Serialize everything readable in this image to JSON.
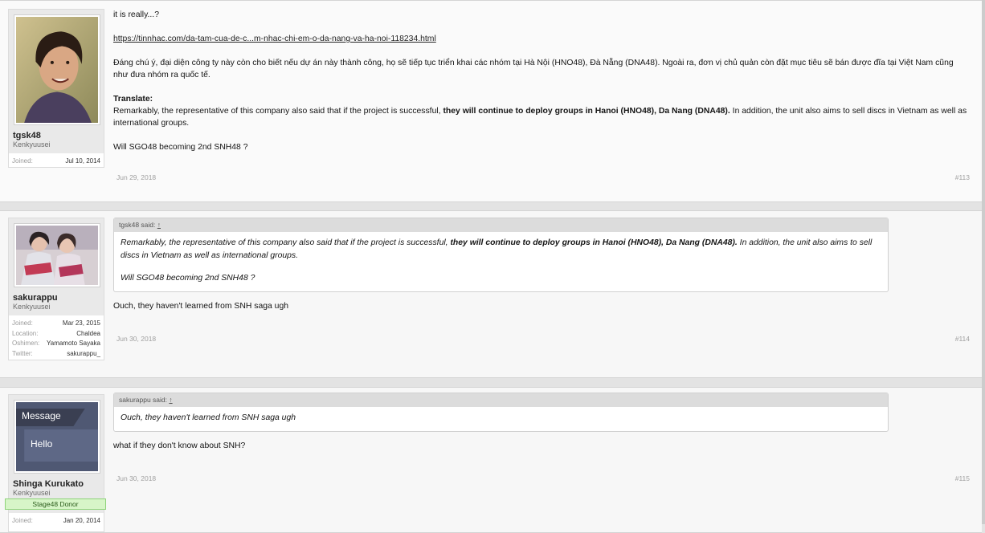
{
  "posts": [
    {
      "user": {
        "name": "tgsk48",
        "title": "Kenkyuusei",
        "joined_label": "Joined:",
        "joined": "Jul 10, 2014"
      },
      "intro": "it is really...?",
      "link": "https://tinnhac.com/da-tam-cua-de-c...m-nhac-chi-em-o-da-nang-va-ha-noi-118234.html",
      "viet": "Đáng chú ý, đại diện công ty này còn cho biết nếu dự án này thành công, họ sẽ tiếp tục triển khai các nhóm tại Hà Nội (HNO48), Đà Nẵng (DNA48). Ngoài ra, đơn vị chủ quản còn đặt mục tiêu sẽ bán được đĩa tại Việt Nam cũng như đưa nhóm ra quốc tế.",
      "translate_label": "Translate:",
      "tr_a": "Remarkably, the representative of this company also said that if the project is successful, ",
      "tr_b": "they will continue to deploy groups in Hanoi (HNO48), Da Nang (DNA48).",
      "tr_c": " In addition, the unit also aims to sell discs in Vietnam as well as international groups.",
      "closing": "Will SGO48 becoming 2nd SNH48 ?",
      "date": "Jun 29, 2018",
      "number": "#113"
    },
    {
      "user": {
        "name": "sakurappu",
        "title": "Kenkyuusei",
        "fields": [
          {
            "label": "Joined:",
            "value": "Mar 23, 2015"
          },
          {
            "label": "Location:",
            "value": "Chaldea"
          },
          {
            "label": "Oshimen:",
            "value": "Yamamoto Sayaka"
          },
          {
            "label": "Twitter:",
            "value": "sakurappu_"
          }
        ]
      },
      "quote_author": "tgsk48 said:",
      "quote_arrow": "↑",
      "q_a": "Remarkably, the representative of this company also said that if the project is successful, ",
      "q_b": "they will continue to deploy groups in Hanoi (HNO48), Da Nang (DNA48).",
      "q_c": " In addition, the unit also aims to sell discs in Vietnam as well as international groups.",
      "q_closing": "Will SGO48 becoming 2nd SNH48 ?",
      "message": "Ouch, they haven't learned from SNH saga ugh",
      "date": "Jun 30, 2018",
      "number": "#114"
    },
    {
      "user": {
        "name": "Shinga Kurukato",
        "title": "Kenkyuusei",
        "banner": "Stage48 Donor",
        "joined_label": "Joined:",
        "joined": "Jan 20, 2014",
        "avatar_top": "Message",
        "avatar_bottom": "Hello"
      },
      "quote_author": "sakurappu said:",
      "quote_arrow": "↑",
      "q_text": "Ouch, they haven't learned from SNH saga ugh",
      "message": "what if they don't know about SNH?",
      "date": "Jun 30, 2018",
      "number": "#115"
    }
  ]
}
